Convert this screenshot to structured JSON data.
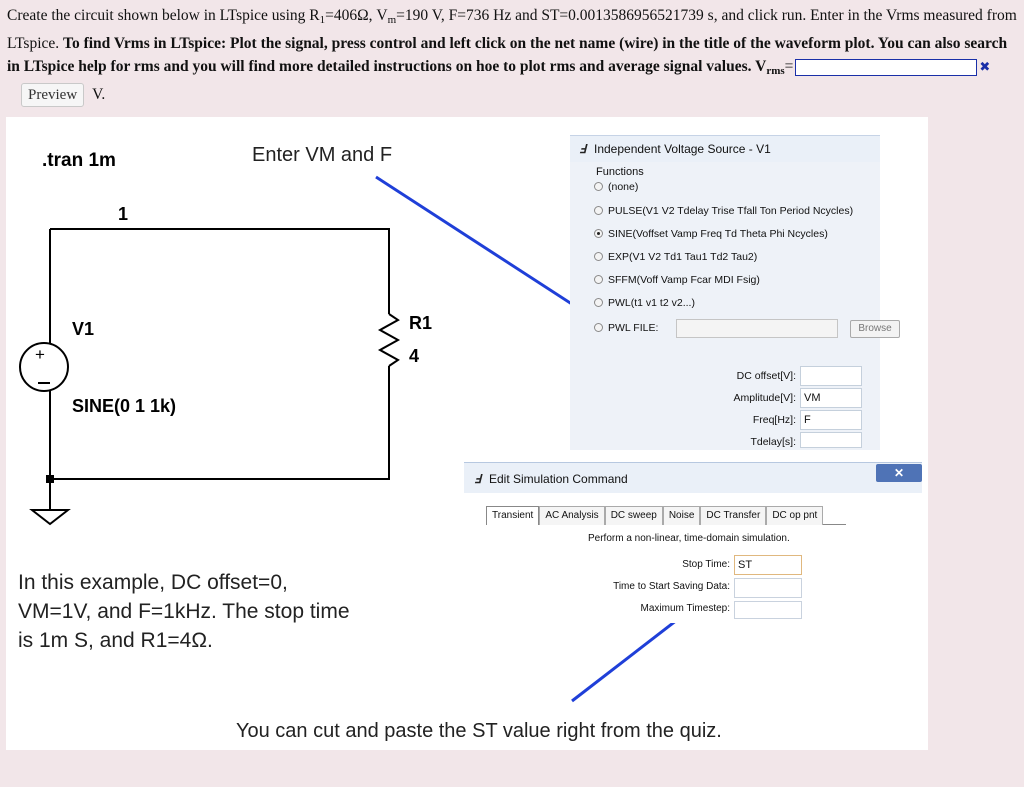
{
  "question": {
    "p1": "Create the circuit shown below in LTspice  using R",
    "sub1": "1",
    "p2": "=406Ω, V",
    "sub2": "m",
    "p3": "=190 V, F=736 Hz and ST=0.0013586956521739 s, and click run. Enter in the Vrms measured from LTspice. ",
    "bold": "To find Vrms in LTspice: Plot the signal, press control and left click on the net name (wire) in the title of the waveform plot.  You can also search in LTspice help for rms and you will find more detailed instructions on hoe to plot rms and average signal values.",
    "answer_prefix": " V",
    "answer_sub": "rms",
    "answer_eq": "=",
    "answer_value": "",
    "invalid_mark": "✖",
    "preview_label": "Preview",
    "unit": "V."
  },
  "figure": {
    "tran": ".tran 1m",
    "enter_vm_f": "Enter VM and F",
    "node1": "1",
    "v1": "V1",
    "sine": "SINE(0 1 1k)",
    "r1": "R1",
    "r1_value": "4",
    "example_line1": "In this example, DC offset=0,",
    "example_line2": "VM=1V, and F=1kHz. The stop time",
    "example_line3": "is 1m S, and R1=4Ω.",
    "cut_paste": "You can cut and paste the ST value right from the quiz.",
    "arrow_color": "#1f3fd8"
  },
  "voltage_dialog": {
    "title": "Independent Voltage Source - V1",
    "functions_label": "Functions",
    "options": [
      "(none)",
      "PULSE(V1 V2 Tdelay Trise Tfall Ton Period Ncycles)",
      "SINE(Voffset Vamp Freq Td Theta Phi Ncycles)",
      "EXP(V1 V2 Td1 Tau1 Td2 Tau2)",
      "SFFM(Voff Vamp Fcar MDI Fsig)",
      "PWL(t1 v1 t2 v2...)",
      "PWL FILE:"
    ],
    "browse": "Browse",
    "dc_offset_label": "DC offset[V]:",
    "dc_offset_value": "",
    "amplitude_label": "Amplitude[V]:",
    "amplitude_value": "VM",
    "freq_label": "Freq[Hz]:",
    "freq_value": "F",
    "tdelay_label": "Tdelay[s]:",
    "tdelay_value": ""
  },
  "sim_dialog": {
    "title": "Edit Simulation Command",
    "close": "✕",
    "tabs": [
      "Transient",
      "AC Analysis",
      "DC sweep",
      "Noise",
      "DC Transfer",
      "DC op pnt"
    ],
    "description": "Perform a non-linear, time-domain simulation.",
    "stop_time_label": "Stop Time:",
    "stop_time_value": "ST",
    "start_saving_label": "Time to Start Saving Data:",
    "start_saving_value": "",
    "max_timestep_label": "Maximum Timestep:",
    "max_timestep_value": ""
  }
}
